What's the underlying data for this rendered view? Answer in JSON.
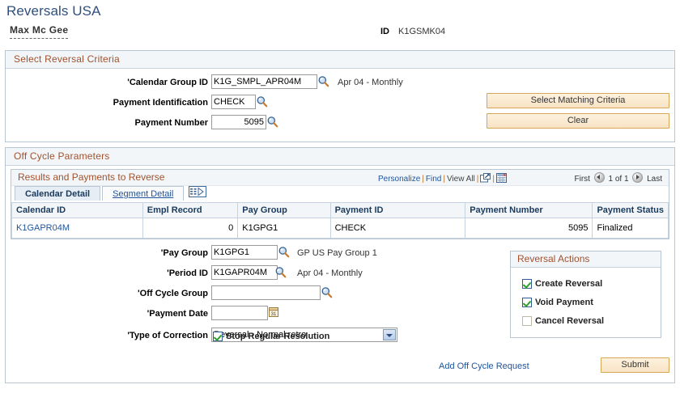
{
  "page": {
    "title": "Reversals USA",
    "person_name": "Max Mc Gee",
    "id_label": "ID",
    "id_value": "K1GSMK04"
  },
  "criteria_section": {
    "header": "Select Reversal Criteria",
    "fields": {
      "calendar_group_id": {
        "label": "Calendar Group ID",
        "value": "K1G_SMPL_APR04M",
        "desc": "Apr 04 - Monthly"
      },
      "payment_identification": {
        "label": "Payment Identification",
        "value": "CHECK",
        "desc": ""
      },
      "payment_number": {
        "label": "Payment Number",
        "value": "5095",
        "desc": ""
      }
    },
    "buttons": {
      "select_matching": "Select Matching Criteria",
      "clear": "Clear"
    }
  },
  "offcycle_section": {
    "header": "Off Cycle Parameters",
    "grid_panel": {
      "title": "Results and Payments to Reverse",
      "nav": {
        "personalize": "Personalize",
        "find": "Find",
        "view_all": "View All",
        "separator": "|",
        "download_icon": "download-icon",
        "grid_icon": "grid-icon"
      },
      "pager": {
        "first": "First",
        "position": "1 of 1",
        "last": "Last"
      },
      "tabs": [
        {
          "label": "Calendar Detail",
          "active": true
        },
        {
          "label": "Segment Detail",
          "active": false
        }
      ],
      "expand_icon": "show-all-columns-icon",
      "columns": [
        "Calendar ID",
        "Empl Record",
        "Pay Group",
        "Payment ID",
        "Payment Number",
        "Payment Status"
      ],
      "rows": [
        {
          "calendar_id": "K1GAPR04M",
          "empl_record": "0",
          "pay_group": "K1GPG1",
          "payment_id": "CHECK",
          "payment_number": "5095",
          "payment_status": "Finalized"
        }
      ]
    },
    "fields": {
      "pay_group": {
        "label": "Pay Group",
        "value": "K1GPG1",
        "desc": "GP US Pay Group 1"
      },
      "period_id": {
        "label": "Period ID",
        "value": "K1GAPR04M",
        "desc": "Apr 04 - Monthly"
      },
      "off_cycle_group": {
        "label": "Off Cycle Group",
        "value": "",
        "desc": ""
      },
      "payment_date": {
        "label": "Payment Date",
        "value": "",
        "desc": ""
      },
      "type_of_correction": {
        "label": "Type of Correction",
        "value": "Reversal - Normal retro"
      }
    },
    "stop_regular_resolution": {
      "label": "Stop Regular Resolution",
      "checked": true
    },
    "reversal_actions": {
      "header": "Reversal Actions",
      "items": [
        {
          "label": "Create Reversal",
          "checked": true
        },
        {
          "label": "Void Payment",
          "checked": true
        },
        {
          "label": "Cancel Reversal",
          "checked": false
        }
      ]
    },
    "add_request_link": "Add Off Cycle Request",
    "submit_button": "Submit"
  },
  "colors": {
    "title": "#2F4F7F",
    "section_header_text": "#A0522D",
    "link": "#21559B",
    "button_bg": "#F8E3C4",
    "button_border": "#D8A657",
    "panel_border": "#B9C6D4",
    "check_green": "#2E9E2E"
  }
}
